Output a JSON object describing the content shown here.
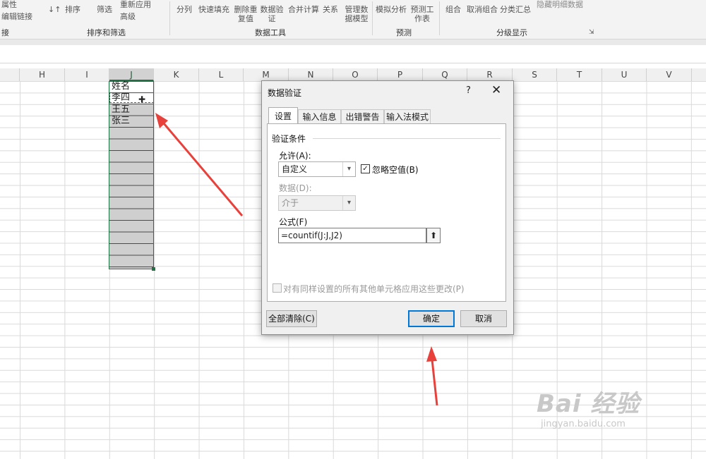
{
  "ribbon": {
    "items": {
      "properties": "属性",
      "edit_links": "编辑链接",
      "sort": "排序",
      "filter": "筛选",
      "reapply": "重新应用",
      "advanced": "高级",
      "text_to_columns": "分列",
      "flash_fill": "快速填充",
      "remove_duplicates": "删除重复值",
      "data_validation": "数据验证",
      "consolidate": "合并计算",
      "relationships": "关系",
      "manage_model": "管理数据模型",
      "what_if": "模拟分析",
      "forecast_sheet": "预测工作表",
      "group": "组合",
      "ungroup": "取消组合",
      "subtotal": "分类汇总",
      "hide_detail": "隐藏明细数据"
    },
    "groups": {
      "connections_tail": "接",
      "sort_filter": "排序和筛选",
      "data_tools": "数据工具",
      "forecast": "预测",
      "outline": "分级显示"
    }
  },
  "columns": [
    "H",
    "I",
    "J",
    "K",
    "L",
    "M",
    "N",
    "O",
    "P",
    "Q",
    "R",
    "S",
    "T",
    "U",
    "V"
  ],
  "sheet": {
    "header_cell": "姓名",
    "cells": [
      "李四",
      "王五",
      "张三"
    ]
  },
  "dialog": {
    "title": "数据验证",
    "help": "?",
    "close": "✕",
    "tabs": [
      "设置",
      "输入信息",
      "出错警告",
      "输入法模式"
    ],
    "section": "验证条件",
    "allow_label": "允许(A):",
    "allow_value": "自定义",
    "ignore_blank_label": "忽略空值(B)",
    "ignore_blank_checked": true,
    "data_label": "数据(D):",
    "data_value": "介于",
    "formula_label": "公式(F)",
    "formula_value": "=countif(J:J,J2)",
    "apply_all_label": "对有同样设置的所有其他单元格应用这些更改(P)",
    "clear_all": "全部清除(C)",
    "ok": "确定",
    "cancel": "取消"
  },
  "watermark": {
    "brand": "Bai 经验",
    "url": "jingyan.baidu.com"
  },
  "colors": {
    "accent_green": "#217346",
    "annotation_red": "#e8413b",
    "focus_blue": "#0078d7"
  }
}
